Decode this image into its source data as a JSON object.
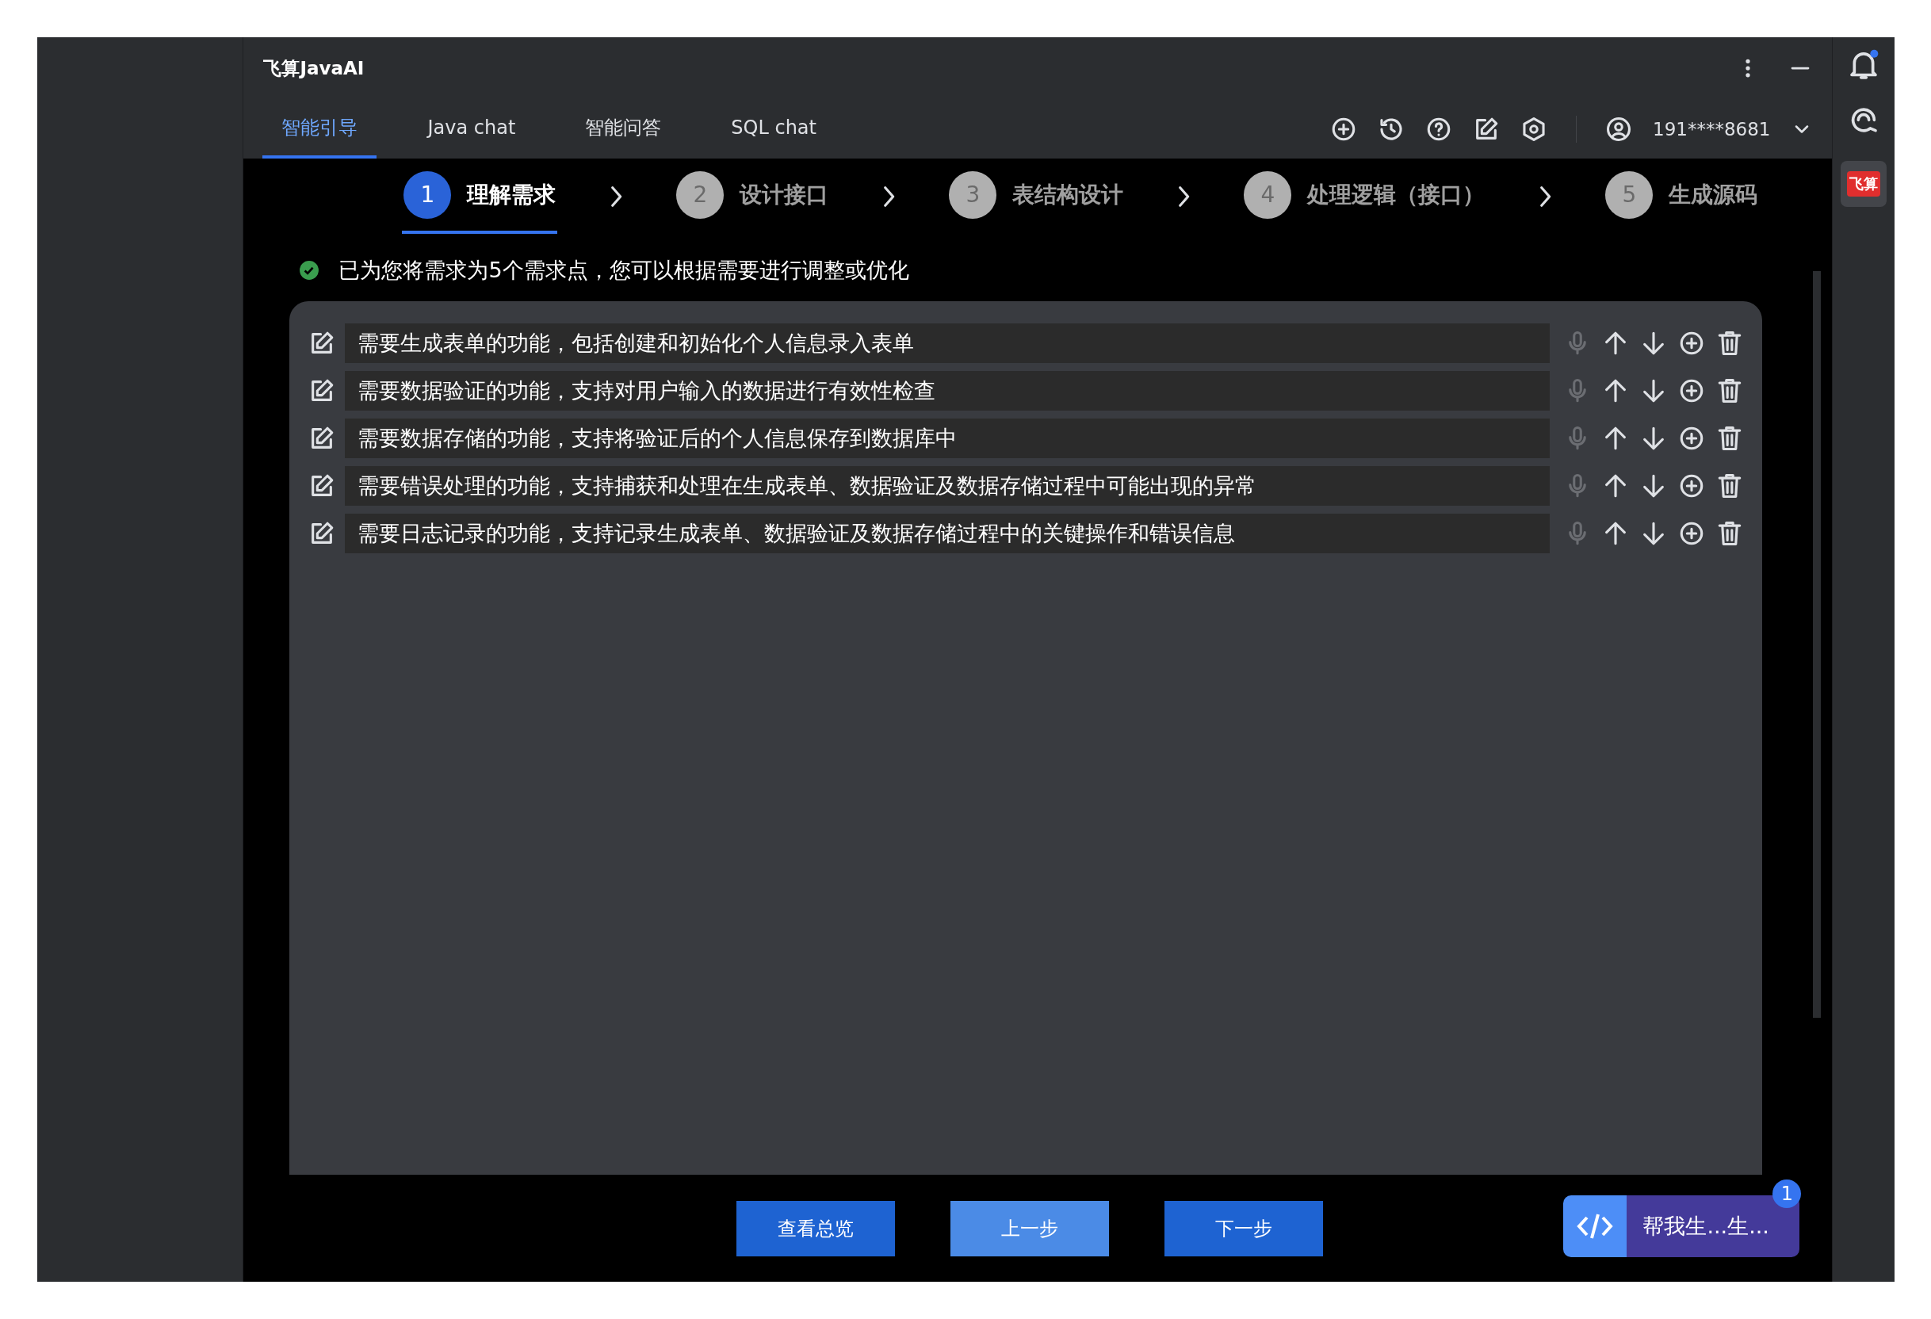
{
  "window": {
    "title": "飞算JavaAI"
  },
  "tabs": [
    {
      "label": "智能引导",
      "selected": true
    },
    {
      "label": "Java chat",
      "selected": false
    },
    {
      "label": "智能问答",
      "selected": false
    },
    {
      "label": "SQL chat",
      "selected": false
    }
  ],
  "user": {
    "account": "191****8681"
  },
  "steps": [
    {
      "number": "1",
      "label": "理解需求",
      "selected": true
    },
    {
      "number": "2",
      "label": "设计接口",
      "selected": false
    },
    {
      "number": "3",
      "label": "表结构设计",
      "selected": false
    },
    {
      "number": "4",
      "label": "处理逻辑（接口）",
      "selected": false
    },
    {
      "number": "5",
      "label": "生成源码",
      "selected": false
    }
  ],
  "message": "已为您将需求为5个需求点，您可以根据需要进行调整或优化",
  "requirements": [
    {
      "text": "需要生成表单的功能，包括创建和初始化个人信息录入表单"
    },
    {
      "text": "需要数据验证的功能，支持对用户输入的数据进行有效性检查"
    },
    {
      "text": "需要数据存储的功能，支持将验证后的个人信息保存到数据库中"
    },
    {
      "text": "需要错误处理的功能，支持捕获和处理在生成表单、数据验证及数据存储过程中可能出现的异常"
    },
    {
      "text": "需要日志记录的功能，支持记录生成表单、数据验证及数据存储过程中的关键操作和错误信息"
    }
  ],
  "buttons": [
    {
      "label": "查看总览",
      "kind": "primary"
    },
    {
      "label": "上一步",
      "kind": "light"
    },
    {
      "label": "下一步",
      "kind": "primary"
    }
  ],
  "assistant": {
    "label": "帮我生...生...",
    "badge": "1"
  },
  "sidebar": {
    "logo": "飞算",
    "notification": true
  }
}
